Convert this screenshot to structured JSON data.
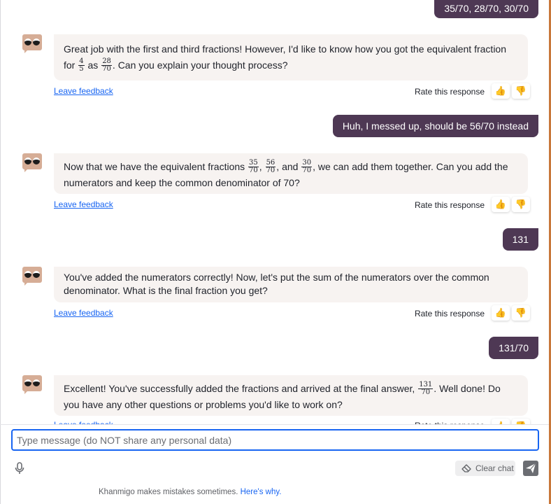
{
  "conversation": {
    "user_messages": [
      "35/70, 28/70, 30/70",
      "Huh, I messed up, should be 56/70 instead",
      "131",
      "131/70"
    ],
    "bot_messages": [
      {
        "part1": "Great job with the first and third fractions! However, I'd like to know how you got the equivalent fraction for ",
        "frac1_num": "4",
        "frac1_den": "5",
        "part2": " as ",
        "frac2_num": "28",
        "frac2_den": "70",
        "part3": ". Can you explain your thought process?"
      },
      {
        "part1": "Now that we have the equivalent fractions ",
        "frac1_num": "35",
        "frac1_den": "70",
        "sep1": ", ",
        "frac2_num": "56",
        "frac2_den": "70",
        "sep2": ", and ",
        "frac3_num": "30",
        "frac3_den": "70",
        "part2": ", we can add them together. Can you add the numerators and keep the common denominator of 70?"
      },
      {
        "text": "You've added the numerators correctly! Now, let's put the sum of the numerators over the common denominator. What is the final fraction you get?"
      },
      {
        "part1": "Excellent! You've successfully added the fractions and arrived at the final answer, ",
        "frac1_num": "131",
        "frac1_den": "70",
        "part2": ". Well done! Do you have any other questions or problems you'd like to work on?"
      }
    ],
    "feedback_link": "Leave feedback",
    "rate_label": "Rate this response"
  },
  "input": {
    "placeholder": "Type message (do NOT share any personal data)",
    "value": ""
  },
  "actions": {
    "clear_chat": "Clear chat"
  },
  "footer": {
    "disclaimer": "Khanmigo makes mistakes sometimes.",
    "link": "Here's why."
  },
  "colors": {
    "user_bubble": "#4e3854",
    "bot_bubble": "#f7f3f1",
    "link": "#1865f2",
    "thumbs": "#e2a31a",
    "avatar": "#d6ad96"
  },
  "icons": [
    "thumbs-up-icon",
    "thumbs-down-icon",
    "microphone-icon",
    "eraser-icon",
    "send-icon",
    "khanmigo-avatar-icon"
  ]
}
